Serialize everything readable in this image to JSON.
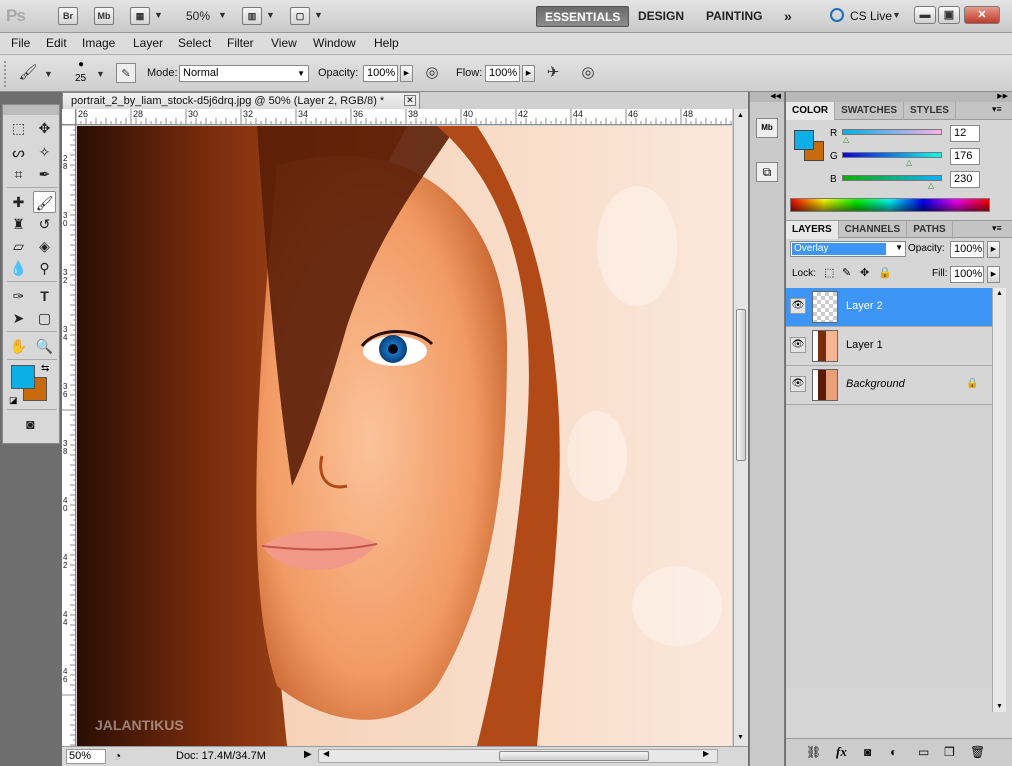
{
  "app": {
    "logo": "Ps",
    "bridge_icon": "Br",
    "minibridge_icon": "Mb",
    "zoom": "50%",
    "workspaces": [
      "ESSENTIALS",
      "DESIGN",
      "PAINTING"
    ],
    "more": "»",
    "cslive": "CS Live",
    "window_controls": [
      "▬",
      "▣",
      "✕"
    ]
  },
  "menu": [
    "File",
    "Edit",
    "Image",
    "Layer",
    "Select",
    "Filter",
    "View",
    "Window",
    "Help"
  ],
  "options": {
    "brush_size": "25",
    "mode_label": "Mode:",
    "mode_value": "Normal",
    "opacity_label": "Opacity:",
    "opacity_value": "100%",
    "flow_label": "Flow:",
    "flow_value": "100%"
  },
  "document": {
    "tab_title": "portrait_2_by_liam_stock-d5j6drq.jpg @ 50% (Layer 2, RGB/8) *",
    "close": "✕",
    "hruler_ticks": [
      "26",
      "28",
      "30",
      "32",
      "34",
      "36",
      "38",
      "40",
      "42",
      "44",
      "46",
      "48"
    ],
    "vruler_ticks": [
      "2\n8",
      "3\n0",
      "3\n2",
      "3\n4",
      "3\n6",
      "3\n8",
      "4\n0",
      "4\n2",
      "4\n4",
      "4\n6"
    ],
    "status_zoom": "50%",
    "status_doc": "Doc: 17.4M/34.7M",
    "watermark": "JALANTIKUS"
  },
  "color_panel": {
    "tabs": [
      "COLOR",
      "SWATCHES",
      "STYLES"
    ],
    "r_label": "R",
    "r_value": "12",
    "g_label": "G",
    "g_value": "176",
    "b_label": "B",
    "b_value": "230",
    "foreground": "#0cb0e6",
    "background": "#c96a0c"
  },
  "layers_panel": {
    "tabs": [
      "LAYERS",
      "CHANNELS",
      "PATHS"
    ],
    "blend_mode": "Overlay",
    "opacity_label": "Opacity:",
    "opacity_value": "100%",
    "lock_label": "Lock:",
    "fill_label": "Fill:",
    "fill_value": "100%",
    "layers": [
      {
        "name": "Layer 2",
        "selected": true
      },
      {
        "name": "Layer 1",
        "selected": false
      },
      {
        "name": "Background",
        "selected": false
      }
    ],
    "footer_icons": [
      "link-icon",
      "fx-icon",
      "mask-icon",
      "adjustment-icon",
      "group-icon",
      "new-layer-icon",
      "trash-icon"
    ],
    "fx_text": "fx"
  },
  "colors": {
    "selection_blue": "#3d95f5",
    "panel_bg": "#d6d6d6"
  }
}
